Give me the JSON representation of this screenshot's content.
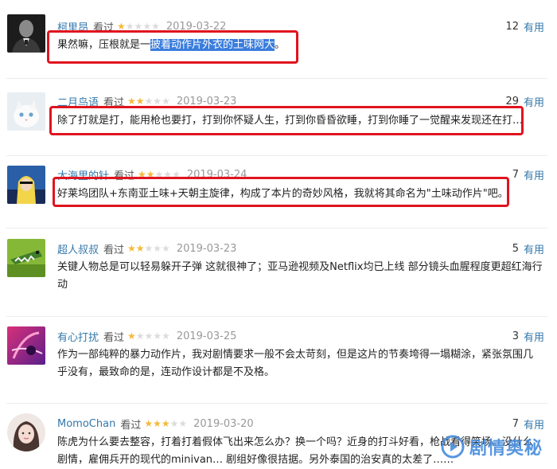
{
  "reviews": [
    {
      "username": "柯里昂",
      "watched": "看过",
      "rating": 1,
      "date": "2019-03-22",
      "votes": "12",
      "useful": "有用",
      "content_pre": "果然嘛，压根就是一",
      "content_hl": "披着动作片外衣的土味网大",
      "content_post": "。"
    },
    {
      "username": "二月鸟语",
      "watched": "看过",
      "rating": 2,
      "date": "2019-03-23",
      "votes": "29",
      "useful": "有用",
      "content": "除了打就是打，能用枪也要打，打到你怀疑人生，打到你昏昏欲睡，打到你睡了一觉醒来发现还在打…"
    },
    {
      "username": "大海里的针",
      "watched": "看过",
      "rating": 2,
      "date": "2019-03-24",
      "votes": "7",
      "useful": "有用",
      "content": "好莱坞团队+东南亚土味+天朝主旋律，构成了本片的奇妙风格，我就将其命名为\"土味动作片\"吧。"
    },
    {
      "username": "超人叔叔",
      "watched": "看过",
      "rating": 2,
      "date": "2019-03-23",
      "votes": "5",
      "useful": "有用",
      "content": "关键人物总是可以轻易躲开子弹 这就很神了；亚马逊视频及Netflix均已上线 部分镜头血腥程度更超红海行动"
    },
    {
      "username": "有心打扰",
      "watched": "看过",
      "rating": 1,
      "date": "2019-03-25",
      "votes": "3",
      "useful": "有用",
      "content": "作为一部纯粹的暴力动作片，我对剧情要求一般不会太苛刻，但是这片的节奏垮得一塌糊涂，紧张氛围几乎没有，最致命的是，连动作设计都是不及格。"
    },
    {
      "username": "MomoChan",
      "watched": "看过",
      "rating": 3,
      "date": "2019-03-20",
      "votes": "7",
      "useful": "有用",
      "content": "陈虎为什么要去整容，打着打着假体飞出来怎么办？换一个吗？近身的打斗好看，枪战看得笑场。没什么剧情，雇佣兵开的现代的minivan… 剧组好像很拮据。另外泰国的治安真的太差了……"
    }
  ],
  "watermark": {
    "text": "剧情奥秘",
    "icon": "play-logo-icon",
    "color": "#468cdc"
  },
  "colors": {
    "link": "#3377aa",
    "star_on": "#f5b93b",
    "star_off": "#dcdcdc",
    "highlight_box": "#e0141e",
    "selection": "#3b7ddd"
  }
}
